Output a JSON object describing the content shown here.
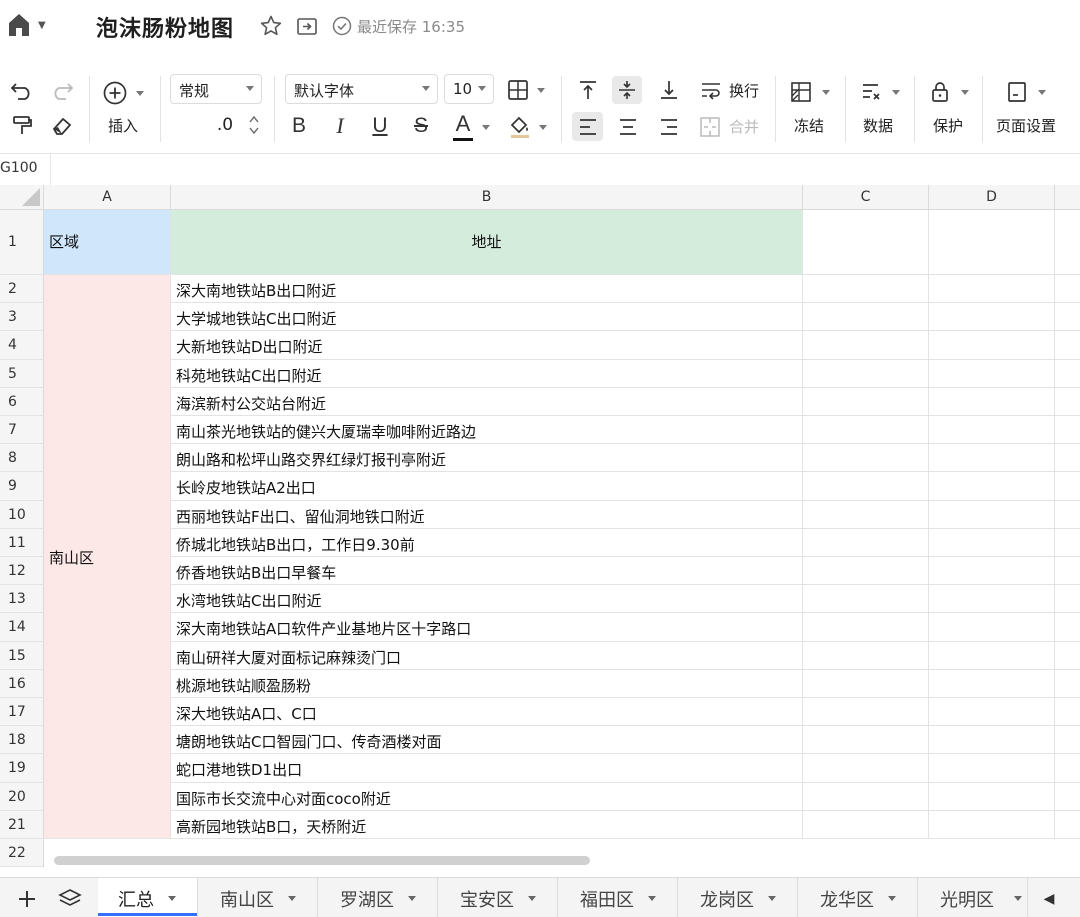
{
  "title_bar": {
    "doc_title": "泡沫肠粉地图",
    "save_status": "最近保存 16:35"
  },
  "toolbar": {
    "insert_label": "插入",
    "number_format": "常规",
    "decimal_label": ".0",
    "font_family": "默认字体",
    "font_size": "10",
    "wrap_label": "换行",
    "merge_label": "合并",
    "freeze_label": "冻结",
    "data_label": "数据",
    "protect_label": "保护",
    "page_setup_label": "页面设置",
    "bold_glyph": "B",
    "italic_glyph": "I",
    "underline_glyph": "U",
    "strike_glyph": "S",
    "font_color_glyph": "A"
  },
  "formula_bar": {
    "cell_ref": "G100"
  },
  "grid": {
    "columns": [
      "A",
      "B",
      "C",
      "D"
    ],
    "header_row": {
      "row": "1",
      "a": "区域",
      "b": "地址"
    },
    "region_label": "南山区",
    "rows": [
      {
        "row": "2",
        "address": "深大南地铁站B出口附近"
      },
      {
        "row": "3",
        "address": "大学城地铁站C出口附近"
      },
      {
        "row": "4",
        "address": "大新地铁站D出口附近"
      },
      {
        "row": "5",
        "address": "科苑地铁站C出口附近"
      },
      {
        "row": "6",
        "address": "海滨新村公交站台附近"
      },
      {
        "row": "7",
        "address": "南山茶光地铁站的健兴大厦瑞幸咖啡附近路边"
      },
      {
        "row": "8",
        "address": "朗山路和松坪山路交界红绿灯报刊亭附近"
      },
      {
        "row": "9",
        "address": "长岭皮地铁站A2出口"
      },
      {
        "row": "10",
        "address": "西丽地铁站F出口、留仙洞地铁口附近"
      },
      {
        "row": "11",
        "address": "侨城北地铁站B出口，工作日9.30前"
      },
      {
        "row": "12",
        "address": "侨香地铁站B出口早餐车"
      },
      {
        "row": "13",
        "address": "水湾地铁站C出口附近"
      },
      {
        "row": "14",
        "address": "深大南地铁站A口软件产业基地片区十字路口"
      },
      {
        "row": "15",
        "address": "南山研祥大厦对面标记麻辣烫门口"
      },
      {
        "row": "16",
        "address": "桃源地铁站顺盈肠粉"
      },
      {
        "row": "17",
        "address": "深大地铁站A口、C口"
      },
      {
        "row": "18",
        "address": "塘朗地铁站C口智园门口、传奇酒楼对面"
      },
      {
        "row": "19",
        "address": "蛇口港地铁D1出口"
      },
      {
        "row": "20",
        "address": "国际市长交流中心对面coco附近"
      },
      {
        "row": "21",
        "address": "高新园地铁站B口，天桥附近"
      }
    ],
    "last_row": "22"
  },
  "sheet_tabs": [
    {
      "label": "汇总",
      "active": true
    },
    {
      "label": "南山区",
      "active": false
    },
    {
      "label": "罗湖区",
      "active": false
    },
    {
      "label": "宝安区",
      "active": false
    },
    {
      "label": "福田区",
      "active": false
    },
    {
      "label": "龙岗区",
      "active": false
    },
    {
      "label": "龙华区",
      "active": false
    },
    {
      "label": "光明区",
      "active": false
    }
  ],
  "colors": {
    "header_a_bg": "#cfe6fb",
    "header_b_bg": "#d4ecdb",
    "region_bg": "#fce8e6",
    "active_tab_underline": "#3370ff"
  }
}
